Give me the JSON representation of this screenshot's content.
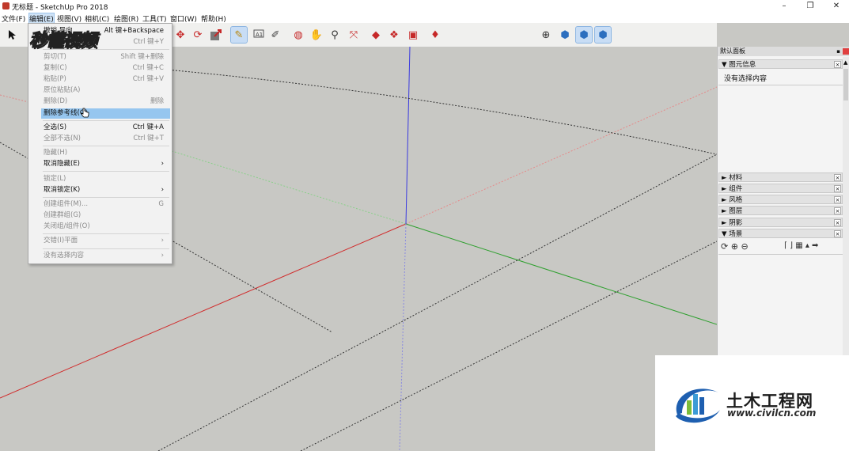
{
  "window": {
    "title": "无标题 - SketchUp Pro 2018",
    "minimize": "–",
    "maximize": "❐",
    "close": "✕"
  },
  "menubar": [
    "文件(F)",
    "编辑(E)",
    "视图(V)",
    "相机(C)",
    "绘图(R)",
    "工具(T)",
    "窗口(W)",
    "帮助(H)"
  ],
  "toolbar_icons": [
    "select-arrow-icon",
    "orbit-icon",
    "pan-icon",
    "zoom-icon",
    "zoom-extents-icon",
    "model-info-icon",
    "components-icon",
    "warehouse-icon",
    "extension-icon",
    "position-camera-icon",
    "section-plane-icon"
  ],
  "edit_menu": {
    "items": [
      {
        "label": "撤销 导向",
        "shortcut": "Alt 键+Backspace",
        "disabled": false
      },
      {
        "label": "重复",
        "shortcut": "Ctrl 键+Y",
        "disabled": true
      },
      {
        "label": "剪切(T)",
        "shortcut": "Shift 键+删除",
        "disabled": true
      },
      {
        "label": "复制(C)",
        "shortcut": "Ctrl 键+C",
        "disabled": true
      },
      {
        "label": "粘贴(P)",
        "shortcut": "Ctrl 键+V",
        "disabled": true
      },
      {
        "label": "原位粘贴(A)",
        "shortcut": "",
        "disabled": true
      },
      {
        "label": "删除(D)",
        "shortcut": "删除",
        "disabled": true
      },
      {
        "label": "删除参考线(G)",
        "shortcut": "",
        "disabled": false,
        "hover": true
      },
      {
        "label": "全选(S)",
        "shortcut": "Ctrl 键+A",
        "disabled": false
      },
      {
        "label": "全部不选(N)",
        "shortcut": "Ctrl 键+T",
        "disabled": true
      },
      {
        "label": "隐藏(H)",
        "shortcut": "",
        "disabled": true
      },
      {
        "label": "取消隐藏(E)",
        "shortcut": "›",
        "disabled": false
      },
      {
        "label": "锁定(L)",
        "shortcut": "",
        "disabled": true
      },
      {
        "label": "取消锁定(K)",
        "shortcut": "›",
        "disabled": false
      },
      {
        "label": "创建组件(M)...",
        "shortcut": "G",
        "disabled": true
      },
      {
        "label": "创建群组(G)",
        "shortcut": "",
        "disabled": true
      },
      {
        "label": "关闭组/组件(O)",
        "shortcut": "",
        "disabled": true
      },
      {
        "label": "交错(I)平面",
        "shortcut": "›",
        "disabled": true
      },
      {
        "label": "没有选择内容",
        "shortcut": "›",
        "disabled": true
      }
    ]
  },
  "watermark": "秒懂视频",
  "tray": {
    "title": "默认面板",
    "entity_info": {
      "header": "▼ 图元信息",
      "content": "没有选择内容"
    },
    "sections": [
      "► 材料",
      "► 组件",
      "► 风格",
      "► 图层",
      "► 阴影",
      "▼ 场景"
    ],
    "close_glyph": "×"
  },
  "corner_logo": {
    "name": "土木工程网",
    "url": "www.civilcn.com"
  },
  "colors": {
    "x_axis": "#d12a2a",
    "y_axis": "#2fa02f",
    "z_axis": "#3a3ae0",
    "hover": "#96c6ef"
  }
}
